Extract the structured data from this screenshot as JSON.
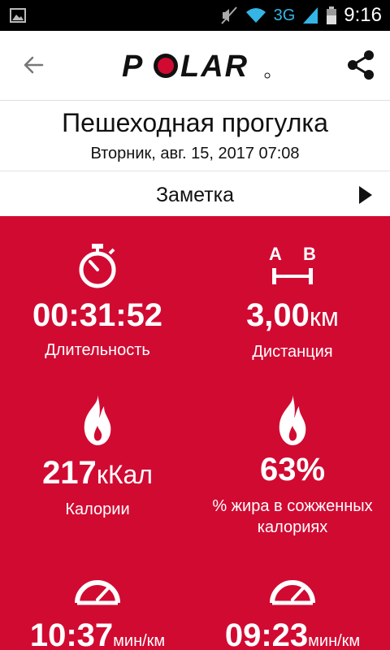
{
  "status_bar": {
    "network": "3G",
    "time": "9:16"
  },
  "toolbar": {
    "logo_text": "POLAR",
    "back_icon": "back-arrow-icon",
    "share_icon": "share-icon"
  },
  "workout": {
    "title": "Пешеходная прогулка",
    "datetime": "Вторник, авг. 15, 2017 07:08"
  },
  "note": {
    "label": "Заметка"
  },
  "stats": {
    "duration": {
      "value": "00:31:52",
      "label": "Длительность",
      "icon": "stopwatch-icon"
    },
    "distance": {
      "value": "3,00",
      "unit": "км",
      "label": "Дистанция",
      "icon": "distance-ab-icon"
    },
    "calories": {
      "value": "217",
      "unit": "кКал",
      "label": "Калории",
      "icon": "flame-icon"
    },
    "fat": {
      "value": "63%",
      "label_line1": "% жира в сожженных",
      "label_line2": "калориях",
      "icon": "flame-icon"
    },
    "pace_avg": {
      "value": "10:37",
      "unit": "мин/км",
      "icon": "speedometer-icon"
    },
    "pace_max": {
      "value": "09:23",
      "unit": "мин/км",
      "icon": "speedometer-icon"
    }
  },
  "colors": {
    "brand_red": "#d10a32",
    "status_blue": "#33b5e5"
  }
}
